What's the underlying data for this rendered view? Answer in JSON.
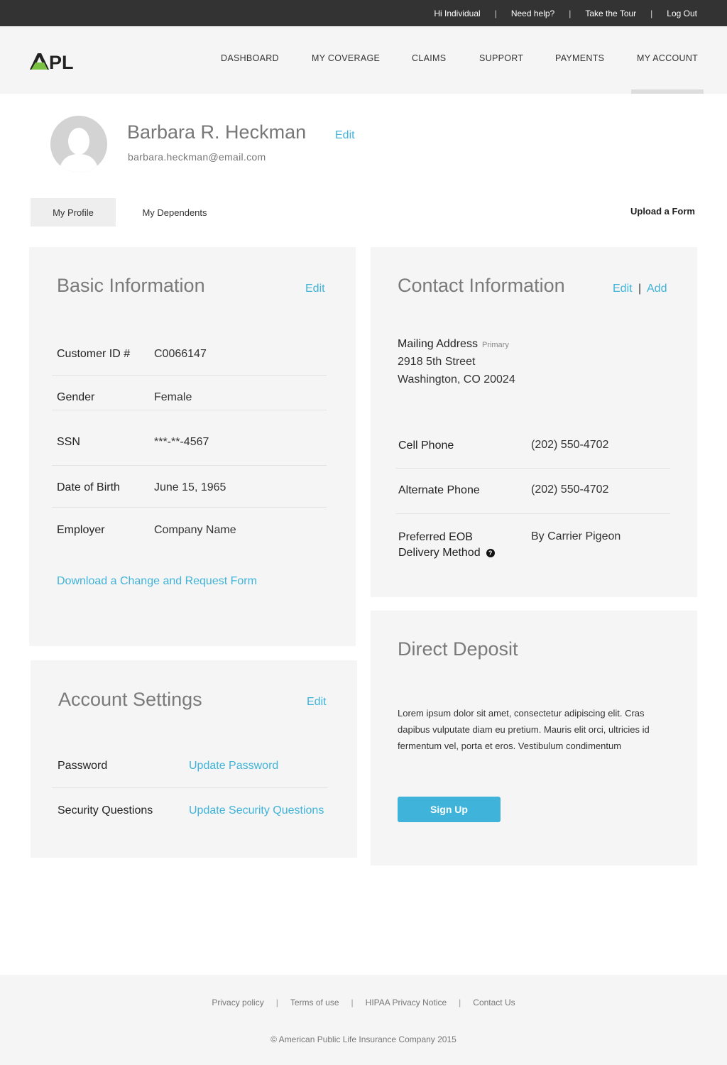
{
  "topbar": {
    "greeting": "Hi Individual",
    "help": "Need help?",
    "tour": "Take the Tour",
    "logout": "Log Out",
    "separator": "|"
  },
  "header": {
    "logo": "APL",
    "nav": [
      "DASHBOARD",
      "MY COVERAGE",
      "CLAIMS",
      "SUPPORT",
      "PAYMENTS",
      "MY ACCOUNT"
    ],
    "active_nav": "MY ACCOUNT"
  },
  "profile": {
    "name": "Barbara R. Heckman",
    "edit": "Edit",
    "email": "barbara.heckman@email.com"
  },
  "tabs": {
    "my_profile": "My Profile",
    "my_dependents": "My Dependents",
    "active": "My Profile",
    "upload": "Upload a Form"
  },
  "basic_info": {
    "title": "Basic Information",
    "edit": "Edit",
    "fields": [
      {
        "label": "Customer ID #",
        "value": "C0066147"
      },
      {
        "label": "Gender",
        "value": "Female"
      },
      {
        "label": "SSN",
        "value": "***-**-4567"
      },
      {
        "label": "Date of Birth",
        "value": "June 15, 1965"
      },
      {
        "label": "Employer",
        "value": "Company Name"
      }
    ],
    "download_link": "Download a Change and Request Form"
  },
  "contact_info": {
    "title": "Contact Information",
    "edit": "Edit",
    "add": "Add",
    "separator": "|",
    "mailing_label": "Mailing Address",
    "mailing_tag": "Primary",
    "address_line1": "2918 5th Street",
    "address_line2": "Washington, CO 20024",
    "cell_label": "Cell Phone",
    "cell_value": "(202) 550-4702",
    "alt_label": "Alternate Phone",
    "alt_value": "(202) 550-4702",
    "eob_label_line1": "Preferred EOB",
    "eob_label_line2": "Delivery Method",
    "eob_help": "?",
    "eob_value": "By Carrier Pigeon"
  },
  "account_settings": {
    "title": "Account Settings",
    "edit": "Edit",
    "password_label": "Password",
    "password_link": "Update Password",
    "security_label": "Security Questions",
    "security_link": "Update Security Questions"
  },
  "direct_deposit": {
    "title": "Direct Deposit",
    "text": "Lorem ipsum dolor sit amet, consectetur adipiscing elit. Cras dapibus vulputate diam eu pretium. Mauris elit orci, ultricies id fermentum vel, porta et eros. Vestibulum condimentum",
    "button": "Sign Up"
  },
  "footer": {
    "links": [
      "Privacy policy",
      "Terms of use",
      "HIPAA Privacy Notice",
      "Contact Us"
    ],
    "separator": "|",
    "copyright": "© American Public Life Insurance Company 2015"
  },
  "colors": {
    "accent": "#3fb3d9",
    "topbar": "#333333",
    "card_bg": "#f5f5f5",
    "logo_green": "#7ac143"
  }
}
